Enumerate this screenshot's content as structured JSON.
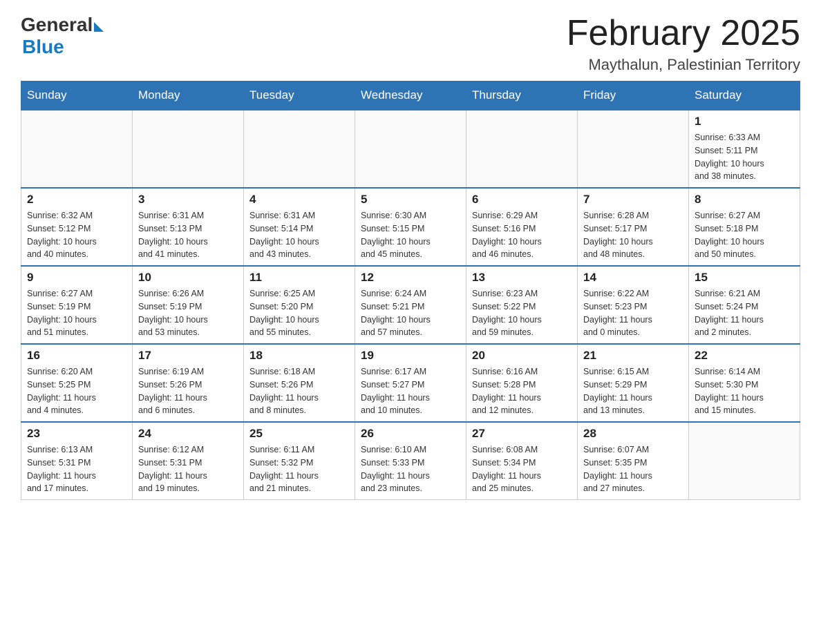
{
  "header": {
    "logo_general": "General",
    "logo_blue": "Blue",
    "month_title": "February 2025",
    "location": "Maythalun, Palestinian Territory"
  },
  "days_of_week": [
    "Sunday",
    "Monday",
    "Tuesday",
    "Wednesday",
    "Thursday",
    "Friday",
    "Saturday"
  ],
  "weeks": [
    [
      {
        "day": "",
        "info": ""
      },
      {
        "day": "",
        "info": ""
      },
      {
        "day": "",
        "info": ""
      },
      {
        "day": "",
        "info": ""
      },
      {
        "day": "",
        "info": ""
      },
      {
        "day": "",
        "info": ""
      },
      {
        "day": "1",
        "info": "Sunrise: 6:33 AM\nSunset: 5:11 PM\nDaylight: 10 hours\nand 38 minutes."
      }
    ],
    [
      {
        "day": "2",
        "info": "Sunrise: 6:32 AM\nSunset: 5:12 PM\nDaylight: 10 hours\nand 40 minutes."
      },
      {
        "day": "3",
        "info": "Sunrise: 6:31 AM\nSunset: 5:13 PM\nDaylight: 10 hours\nand 41 minutes."
      },
      {
        "day": "4",
        "info": "Sunrise: 6:31 AM\nSunset: 5:14 PM\nDaylight: 10 hours\nand 43 minutes."
      },
      {
        "day": "5",
        "info": "Sunrise: 6:30 AM\nSunset: 5:15 PM\nDaylight: 10 hours\nand 45 minutes."
      },
      {
        "day": "6",
        "info": "Sunrise: 6:29 AM\nSunset: 5:16 PM\nDaylight: 10 hours\nand 46 minutes."
      },
      {
        "day": "7",
        "info": "Sunrise: 6:28 AM\nSunset: 5:17 PM\nDaylight: 10 hours\nand 48 minutes."
      },
      {
        "day": "8",
        "info": "Sunrise: 6:27 AM\nSunset: 5:18 PM\nDaylight: 10 hours\nand 50 minutes."
      }
    ],
    [
      {
        "day": "9",
        "info": "Sunrise: 6:27 AM\nSunset: 5:19 PM\nDaylight: 10 hours\nand 51 minutes."
      },
      {
        "day": "10",
        "info": "Sunrise: 6:26 AM\nSunset: 5:19 PM\nDaylight: 10 hours\nand 53 minutes."
      },
      {
        "day": "11",
        "info": "Sunrise: 6:25 AM\nSunset: 5:20 PM\nDaylight: 10 hours\nand 55 minutes."
      },
      {
        "day": "12",
        "info": "Sunrise: 6:24 AM\nSunset: 5:21 PM\nDaylight: 10 hours\nand 57 minutes."
      },
      {
        "day": "13",
        "info": "Sunrise: 6:23 AM\nSunset: 5:22 PM\nDaylight: 10 hours\nand 59 minutes."
      },
      {
        "day": "14",
        "info": "Sunrise: 6:22 AM\nSunset: 5:23 PM\nDaylight: 11 hours\nand 0 minutes."
      },
      {
        "day": "15",
        "info": "Sunrise: 6:21 AM\nSunset: 5:24 PM\nDaylight: 11 hours\nand 2 minutes."
      }
    ],
    [
      {
        "day": "16",
        "info": "Sunrise: 6:20 AM\nSunset: 5:25 PM\nDaylight: 11 hours\nand 4 minutes."
      },
      {
        "day": "17",
        "info": "Sunrise: 6:19 AM\nSunset: 5:26 PM\nDaylight: 11 hours\nand 6 minutes."
      },
      {
        "day": "18",
        "info": "Sunrise: 6:18 AM\nSunset: 5:26 PM\nDaylight: 11 hours\nand 8 minutes."
      },
      {
        "day": "19",
        "info": "Sunrise: 6:17 AM\nSunset: 5:27 PM\nDaylight: 11 hours\nand 10 minutes."
      },
      {
        "day": "20",
        "info": "Sunrise: 6:16 AM\nSunset: 5:28 PM\nDaylight: 11 hours\nand 12 minutes."
      },
      {
        "day": "21",
        "info": "Sunrise: 6:15 AM\nSunset: 5:29 PM\nDaylight: 11 hours\nand 13 minutes."
      },
      {
        "day": "22",
        "info": "Sunrise: 6:14 AM\nSunset: 5:30 PM\nDaylight: 11 hours\nand 15 minutes."
      }
    ],
    [
      {
        "day": "23",
        "info": "Sunrise: 6:13 AM\nSunset: 5:31 PM\nDaylight: 11 hours\nand 17 minutes."
      },
      {
        "day": "24",
        "info": "Sunrise: 6:12 AM\nSunset: 5:31 PM\nDaylight: 11 hours\nand 19 minutes."
      },
      {
        "day": "25",
        "info": "Sunrise: 6:11 AM\nSunset: 5:32 PM\nDaylight: 11 hours\nand 21 minutes."
      },
      {
        "day": "26",
        "info": "Sunrise: 6:10 AM\nSunset: 5:33 PM\nDaylight: 11 hours\nand 23 minutes."
      },
      {
        "day": "27",
        "info": "Sunrise: 6:08 AM\nSunset: 5:34 PM\nDaylight: 11 hours\nand 25 minutes."
      },
      {
        "day": "28",
        "info": "Sunrise: 6:07 AM\nSunset: 5:35 PM\nDaylight: 11 hours\nand 27 minutes."
      },
      {
        "day": "",
        "info": ""
      }
    ]
  ]
}
